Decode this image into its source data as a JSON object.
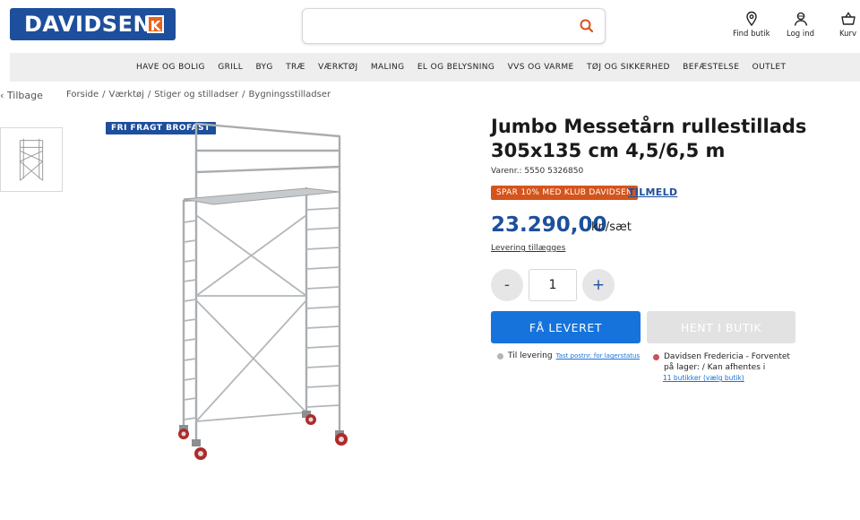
{
  "brand": {
    "name": "DAVIDSEN",
    "k": "K"
  },
  "search": {
    "placeholder": ""
  },
  "header": {
    "find_store": "Find butik",
    "login": "Log ind",
    "cart": "Kurv"
  },
  "nav": {
    "items": [
      "HAVE OG BOLIG",
      "GRILL",
      "BYG",
      "TRÆ",
      "VÆRKTØJ",
      "MALING",
      "EL OG BELYSNING",
      "VVS OG VARME",
      "TØJ OG SIKKERHED",
      "BEFÆSTELSE",
      "OUTLET"
    ]
  },
  "breadcrumb": {
    "back": "Tilbage",
    "items": [
      "Forside",
      "Værktøj",
      "Stiger og stilladser",
      "Bygningsstilladser"
    ]
  },
  "product": {
    "badge": "FRI FRAGT BROFAST",
    "title": "Jumbo Messetårn rullestillads 305x135 cm 4,5/6,5 m",
    "sku": "Varenr.: 5550 5326850",
    "promo": "SPAR 10% MED KLUB DAVIDSEN",
    "promo_link": "TILMELD",
    "price": "23.290,00",
    "unit": "kr./sæt",
    "delivery_note": "Levering tillægges",
    "quantity": "1",
    "minus": "-",
    "plus": "+",
    "btn_deliver": "FÅ LEVERET",
    "btn_store": "HENT I BUTIK",
    "delivery_status": "Til levering",
    "delivery_status_link": "Tast postnr. for lagerstatus",
    "store_status": "Davidsen Fredericia - Forventet på lager: / Kan afhentes i",
    "store_status_link": "11 butikker (vælg butik)"
  },
  "colors": {
    "brand_blue": "#1d4f9c",
    "primary_button": "#1673db",
    "promo_orange": "#d4541c",
    "disabled_gray": "#e2e2e2",
    "status_gray": "#b5b5b5",
    "status_red": "#c9515b"
  }
}
